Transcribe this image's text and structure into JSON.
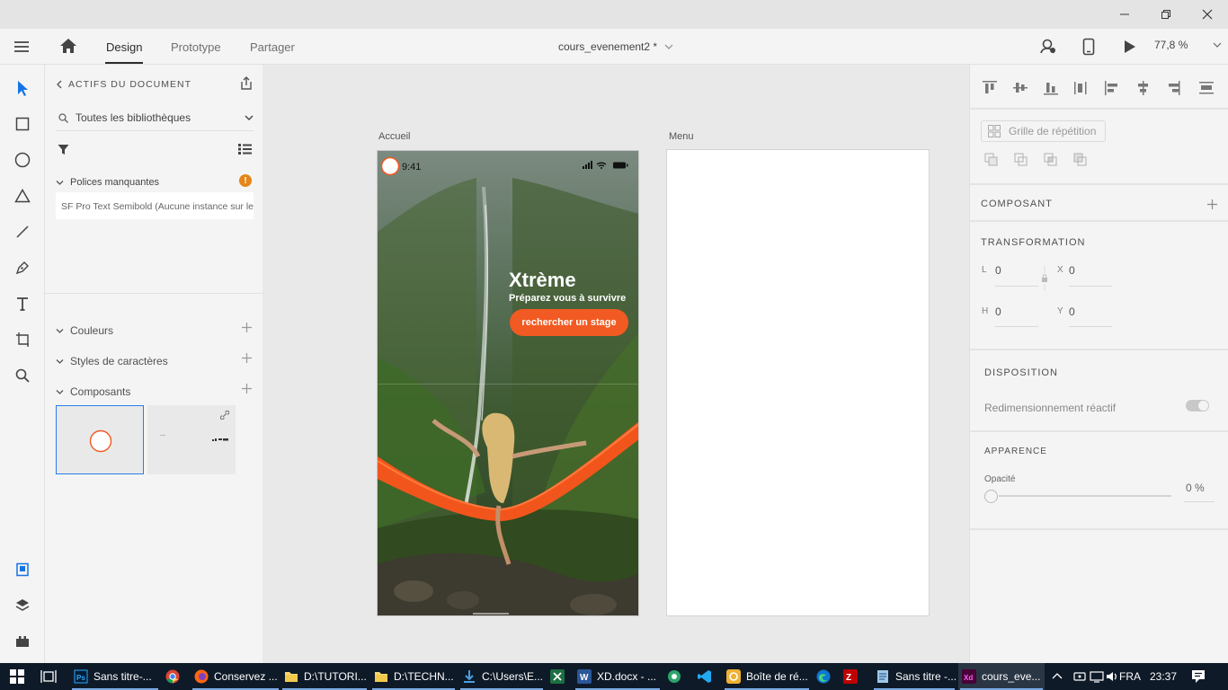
{
  "window": {
    "minimize": "minimize",
    "restore": "restore",
    "close": "close"
  },
  "topbar": {
    "tabs": [
      {
        "label": "Design"
      },
      {
        "label": "Prototype"
      },
      {
        "label": "Partager"
      }
    ],
    "doc_title": "cours_evenement2 *",
    "zoom": "77,8 %"
  },
  "assets": {
    "header": "ACTIFS DU DOCUMENT",
    "library_select": "Toutes les bibliothèques",
    "missing_fonts_label": "Polices manquantes",
    "missing_font_item": "SF Pro Text Semibold (Aucune instance sur le",
    "sections": [
      {
        "label": "Couleurs"
      },
      {
        "label": "Styles de caractères"
      },
      {
        "label": "Composants"
      }
    ],
    "component_thumb2_text": "..."
  },
  "artboards": [
    {
      "label": "Accueil",
      "status_time": "9:41",
      "title": "Xtrème",
      "subtitle": "Préparez vous à survivre",
      "cta": "rechercher un stage"
    },
    {
      "label": "Menu"
    }
  ],
  "props": {
    "repeat_grid": "Grille de répétition",
    "component_title": "COMPOSANT",
    "transform_title": "TRANSFORMATION",
    "l_label": "L",
    "l_value": "0",
    "x_label": "X",
    "x_value": "0",
    "h_label": "H",
    "h_value": "0",
    "y_label": "Y",
    "y_value": "0",
    "layout_title": "DISPOSITION",
    "responsive_label": "Redimensionnement réactif",
    "responsive_on": true,
    "appearance_title": "APPARENCE",
    "opacity_label": "Opacité",
    "opacity_value": "0 %",
    "opacity_level": 0
  },
  "taskbar": {
    "items": [
      {
        "label": "Sans titre-...",
        "icon": "photoshop-icon"
      },
      {
        "label": "",
        "icon": "chrome-icon"
      },
      {
        "label": "Conservez ...",
        "icon": "firefox-icon"
      },
      {
        "label": "D:\\TUTORI...",
        "icon": "folder-icon"
      },
      {
        "label": "D:\\TECHN...",
        "icon": "folder-icon"
      },
      {
        "label": "C:\\Users\\E...",
        "icon": "download-icon"
      },
      {
        "label": "",
        "icon": "excel-icon"
      },
      {
        "label": "XD.docx - ...",
        "icon": "word-icon"
      },
      {
        "label": "",
        "icon": "app-icon"
      },
      {
        "label": "",
        "icon": "vscode-icon"
      },
      {
        "label": "Boîte de ré...",
        "icon": "mail-icon"
      },
      {
        "label": "",
        "icon": "edge-icon"
      },
      {
        "label": "",
        "icon": "filezilla-icon"
      },
      {
        "label": "Sans titre -...",
        "icon": "notepad-icon"
      },
      {
        "label": "cours_eve...",
        "icon": "xd-icon"
      }
    ],
    "language": "FRA",
    "time": "23:37"
  },
  "colors": {
    "accent_orange": "#f15a22",
    "xd_purple": "#470137",
    "select_blue": "#1473e6"
  }
}
